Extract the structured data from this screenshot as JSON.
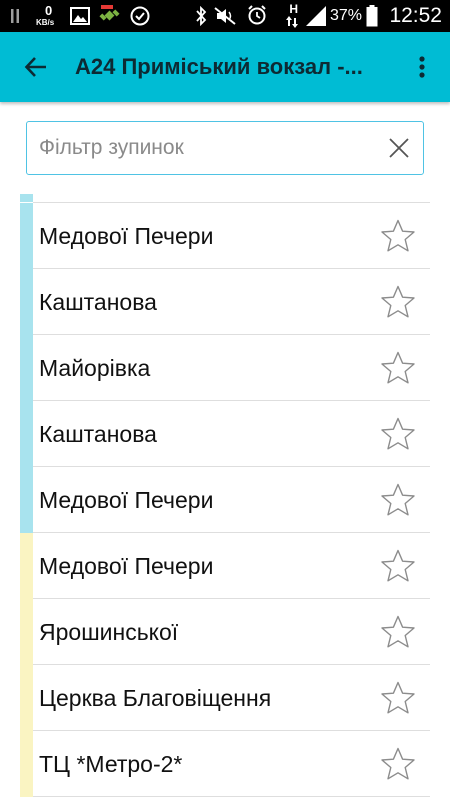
{
  "status_bar": {
    "net_speed_value": "0",
    "net_speed_unit": "KB/s",
    "network_type": "H",
    "battery_percent": "37%",
    "time": "12:52",
    "icons_left": [
      "pause-icon",
      "image-icon",
      "satellite-icon",
      "check-circle-icon"
    ],
    "icons_right": [
      "bluetooth-icon",
      "mute-icon",
      "alarm-icon",
      "data-arrows-icon",
      "signal-icon",
      "battery-icon"
    ]
  },
  "app_bar": {
    "title": "А24 Приміський вокзал -...",
    "background": "#00bcd4",
    "back_icon": "arrow-left-icon",
    "menu_icon": "more-vert-icon"
  },
  "filter": {
    "value": "",
    "placeholder": "Фільтр зупинок",
    "clear_icon": "close-icon",
    "border_color": "#4fc3e4"
  },
  "stops": {
    "colors": {
      "group_a": "#a8e3ee",
      "group_b": "#faf4c2"
    },
    "items": [
      {
        "name": "Медової Печери",
        "group": "group_a",
        "favorite": false
      },
      {
        "name": "Каштанова",
        "group": "group_a",
        "favorite": false
      },
      {
        "name": "Майорівка",
        "group": "group_a",
        "favorite": false
      },
      {
        "name": "Каштанова",
        "group": "group_a",
        "favorite": false
      },
      {
        "name": "Медової Печери",
        "group": "group_a",
        "favorite": false
      },
      {
        "name": "Медової Печери",
        "group": "group_b",
        "favorite": false
      },
      {
        "name": "Ярошинської",
        "group": "group_b",
        "favorite": false
      },
      {
        "name": "Церква Благовіщення",
        "group": "group_b",
        "favorite": false
      },
      {
        "name": "ТЦ *Метро-2*",
        "group": "group_b",
        "favorite": false
      }
    ]
  }
}
